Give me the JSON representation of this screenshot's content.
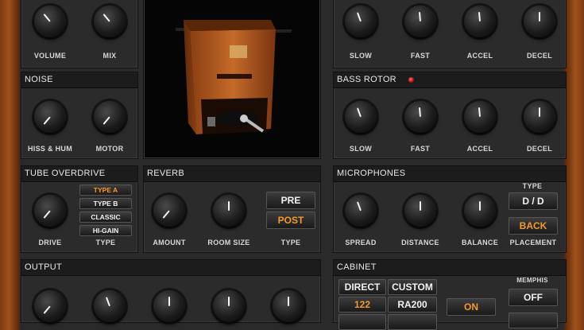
{
  "top_left": {
    "knobs": [
      {
        "label": "VOLUME"
      },
      {
        "label": "MIX"
      }
    ]
  },
  "top_right": {
    "knobs": [
      {
        "label": "SLOW"
      },
      {
        "label": "FAST"
      },
      {
        "label": "ACCEL"
      },
      {
        "label": "DECEL"
      }
    ]
  },
  "noise": {
    "title": "NOISE",
    "knobs": [
      {
        "label": "HISS & HUM"
      },
      {
        "label": "MOTOR"
      }
    ]
  },
  "bass_rotor": {
    "title": "BASS ROTOR",
    "knobs": [
      {
        "label": "SLOW"
      },
      {
        "label": "FAST"
      },
      {
        "label": "ACCEL"
      },
      {
        "label": "DECEL"
      }
    ]
  },
  "tube_overdrive": {
    "title": "TUBE OVERDRIVE",
    "drive_label": "DRIVE",
    "type_label": "TYPE",
    "types": [
      "TYPE A",
      "TYPE B",
      "CLASSIC",
      "HI-GAIN"
    ],
    "selected_type": "TYPE A"
  },
  "reverb": {
    "title": "REVERB",
    "knobs": [
      {
        "label": "AMOUNT"
      },
      {
        "label": "ROOM SIZE"
      }
    ],
    "type_label": "TYPE",
    "pre_label": "PRE",
    "post_label": "POST",
    "selected": "POST"
  },
  "microphones": {
    "title": "MICROPHONES",
    "knobs": [
      {
        "label": "SPREAD"
      },
      {
        "label": "DISTANCE"
      },
      {
        "label": "BALANCE"
      }
    ],
    "type_heading": "TYPE",
    "type_value": "D / D",
    "placement_value": "BACK",
    "placement_label": "PLACEMENT"
  },
  "output": {
    "title": "OUTPUT"
  },
  "cabinet": {
    "title": "CABINET",
    "direct_label": "DIRECT",
    "custom_label": "CUSTOM",
    "model_122": "122",
    "model_ra200": "RA200",
    "on_label": "ON",
    "memphis_label": "MEMPHIS",
    "memphis_value": "OFF"
  },
  "colors": {
    "accent": "#f29a2e",
    "panel": "#2b2b2b",
    "wood": "#a0521c"
  }
}
